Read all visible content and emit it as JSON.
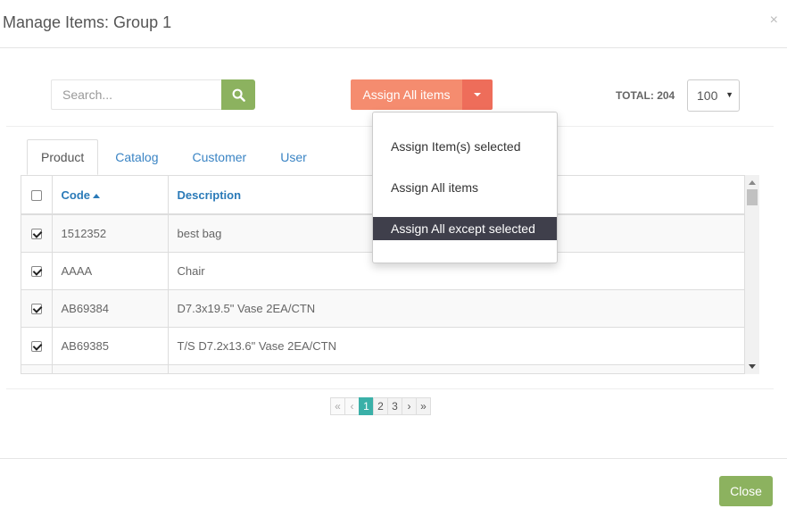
{
  "dialog": {
    "title": "Manage Items: Group 1",
    "close_glyph": "×"
  },
  "toolbar": {
    "search_placeholder": "Search...",
    "search_icon": "search-icon",
    "assign_label": "Assign All items",
    "total_label": "TOTAL: 204",
    "page_size": "100",
    "page_size_arrow": "▼"
  },
  "dropdown": {
    "items": [
      {
        "label": "Assign Item(s) selected"
      },
      {
        "label": "Assign All items"
      },
      {
        "label": "Assign All except selected",
        "highlighted": true
      }
    ]
  },
  "tabs": [
    {
      "label": "Product",
      "active": true
    },
    {
      "label": "Catalog"
    },
    {
      "label": "Customer"
    },
    {
      "label": "User"
    }
  ],
  "table": {
    "headers": {
      "code": "Code",
      "description": "Description"
    },
    "sort": {
      "column": "code",
      "direction": "asc"
    },
    "rows": [
      {
        "checked": true,
        "code": "1512352",
        "description": "best bag"
      },
      {
        "checked": true,
        "code": "AAAA",
        "description": "Chair"
      },
      {
        "checked": true,
        "code": "AB69384",
        "description": "D7.3x19.5\" Vase 2EA/CTN"
      },
      {
        "checked": true,
        "code": "AB69385",
        "description": "T/S D7.2x13.6\" Vase 2EA/CTN"
      }
    ]
  },
  "pagination": {
    "first": "«",
    "prev": "‹",
    "pages": [
      "1",
      "2",
      "3"
    ],
    "current": "1",
    "next": "›",
    "last": "»"
  },
  "footer": {
    "close_label": "Close"
  },
  "colors": {
    "accent_green": "#8cb25f",
    "assign_orange": "#f58c6f",
    "assign_caret": "#ee6d5a",
    "link_blue": "#3a84c4",
    "page_active": "#3ab0a8",
    "menu_highlight": "#3f3f4b"
  }
}
